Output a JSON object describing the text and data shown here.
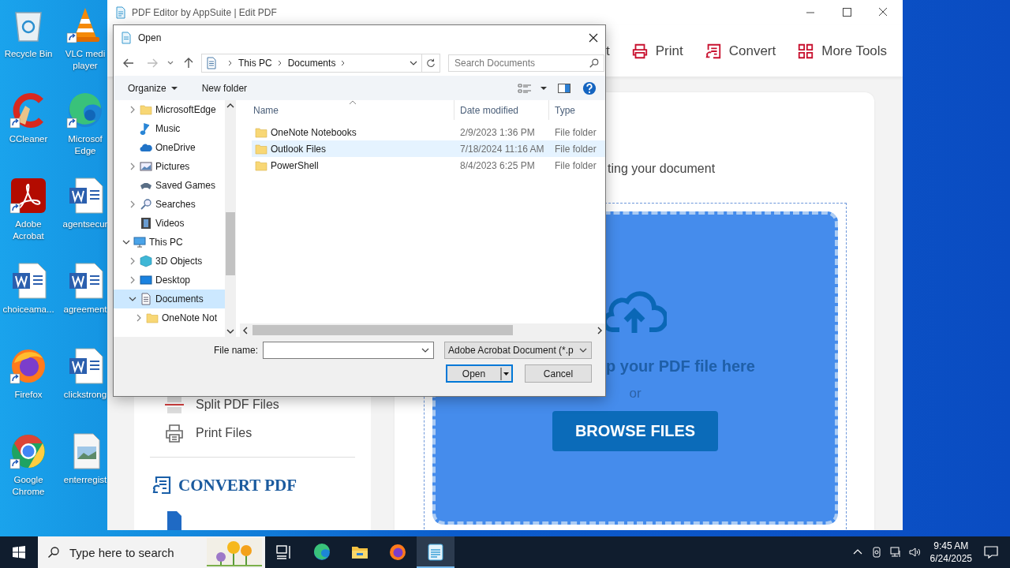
{
  "desktop_icons": [
    {
      "label": "Recycle Bin",
      "kind": "recycle",
      "shortcut": false
    },
    {
      "label": "CCleaner",
      "kind": "ccleaner",
      "shortcut": true
    },
    {
      "label": "Adobe Acrobat",
      "kind": "acrobat",
      "shortcut": true
    },
    {
      "label": "choiceama...",
      "kind": "word",
      "shortcut": false
    },
    {
      "label": "Firefox",
      "kind": "firefox",
      "shortcut": true
    },
    {
      "label": "Google Chrome",
      "kind": "chrome",
      "shortcut": true
    },
    {
      "label": "VLC medi player",
      "kind": "vlc",
      "shortcut": true
    },
    {
      "label": "Microsof Edge",
      "kind": "edge",
      "shortcut": true
    },
    {
      "label": "agentsecur",
      "kind": "word",
      "shortcut": false
    },
    {
      "label": "agreement",
      "kind": "word",
      "shortcut": false
    },
    {
      "label": "clickstrong",
      "kind": "word",
      "shortcut": false
    },
    {
      "label": "enterregist",
      "kind": "image",
      "shortcut": false
    }
  ],
  "app": {
    "title": "PDF Editor by AppSuite | Edit PDF",
    "toolbar": [
      {
        "label": "t",
        "kind": "text"
      },
      {
        "label": "Print",
        "kind": "printer"
      },
      {
        "label": "Convert",
        "kind": "convert"
      },
      {
        "label": "More Tools",
        "kind": "grid"
      }
    ],
    "sidebar": {
      "items": [
        {
          "label": "Split PDF Files",
          "kind": "split"
        },
        {
          "label": "Print Files",
          "kind": "printer"
        }
      ],
      "section_title": "CONVERT PDF"
    },
    "main": {
      "subtitle": "ting your document",
      "drop_text": "p your PDF file here",
      "or": "or",
      "browse_button": "BROWSE FILES"
    }
  },
  "dialog": {
    "title": "Open",
    "address": [
      "This PC",
      "Documents"
    ],
    "search": {
      "placeholder": "Search Documents"
    },
    "organize": "Organize",
    "new_folder": "New folder",
    "tree": [
      {
        "children": [
          {
            "label": "MicrosoftEdge",
            "kind": "folder",
            "expanded": false,
            "selected": false
          },
          {
            "label": "Music",
            "kind": "music",
            "selected": false
          },
          {
            "label": "OneDrive",
            "kind": "cloud",
            "selected": false
          },
          {
            "label": "Pictures",
            "kind": "pictures",
            "expanded": false,
            "selected": false
          },
          {
            "label": "Saved Games",
            "kind": "games",
            "selected": false
          },
          {
            "label": "Searches",
            "kind": "search",
            "expanded": false,
            "selected": false
          },
          {
            "label": "Videos",
            "kind": "videos",
            "selected": false
          }
        ]
      },
      {
        "label": "This PC",
        "kind": "pc",
        "expanded": true,
        "selected": false,
        "children": [
          {
            "label": "3D Objects",
            "kind": "cube",
            "expanded": false,
            "selected": false
          },
          {
            "label": "Desktop",
            "kind": "desktop",
            "expanded": false,
            "selected": false
          },
          {
            "label": "Documents",
            "kind": "documents",
            "expanded": true,
            "selected": true,
            "children": [
              {
                "label": "OneNote Not",
                "kind": "folder",
                "expanded": false,
                "selected": false
              }
            ]
          }
        ]
      }
    ],
    "columns": [
      "Name",
      "Date modified",
      "Type"
    ],
    "files": [
      {
        "name": "OneNote Notebooks",
        "date": "2/9/2023 1:36 PM",
        "type": "File folder",
        "selected": false
      },
      {
        "name": "Outlook Files",
        "date": "7/18/2024 11:16 AM",
        "type": "File folder",
        "selected": true
      },
      {
        "name": "PowerShell",
        "date": "8/4/2023 6:25 PM",
        "type": "File folder",
        "selected": false
      }
    ],
    "file_name_label": "File name:",
    "filter": "Adobe Acrobat Document (*.p",
    "open_button": "Open",
    "cancel_button": "Cancel"
  },
  "taskbar": {
    "search": {
      "placeholder": "Type here to search"
    },
    "apps": [
      {
        "kind": "taskview",
        "selected": false
      },
      {
        "kind": "edge",
        "selected": false
      },
      {
        "kind": "explorer",
        "selected": false
      },
      {
        "kind": "firefox",
        "selected": false
      },
      {
        "kind": "pdf",
        "selected": true
      }
    ],
    "time": "9:45 AM",
    "date": "6/24/2025"
  }
}
